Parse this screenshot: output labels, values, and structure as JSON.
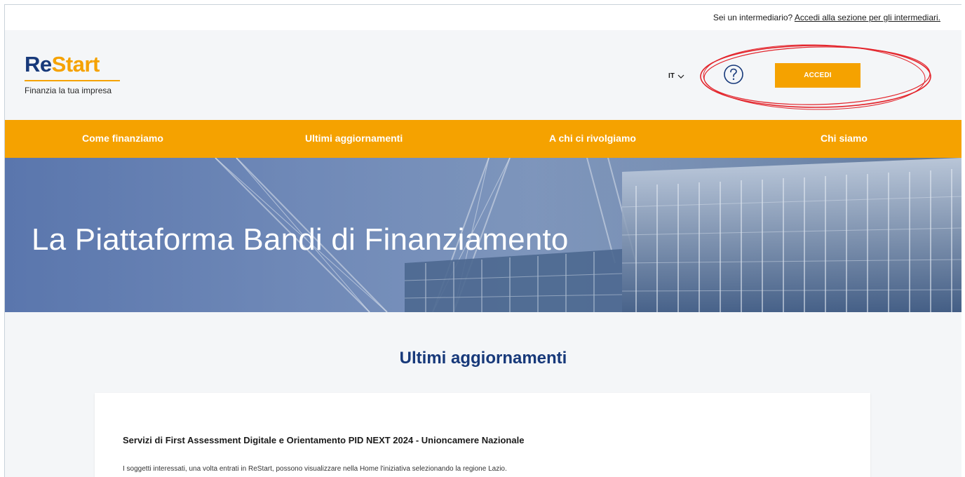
{
  "topbar": {
    "question": "Sei un intermediario?",
    "link": "Accedi alla sezione per gli intermediari."
  },
  "logo": {
    "part1": "Re",
    "part2": "Start",
    "tagline": "Finanzia la tua impresa"
  },
  "header": {
    "language": "IT",
    "help_icon": "question-circle-icon",
    "login_label": "ACCEDI"
  },
  "nav": {
    "items": [
      {
        "label": "Come finanziamo"
      },
      {
        "label": "Ultimi aggiornamenti"
      },
      {
        "label": "A chi ci rivolgiamo"
      },
      {
        "label": "Chi siamo"
      }
    ]
  },
  "hero": {
    "title": "La Piattaforma Bandi di Finanziamento"
  },
  "updates": {
    "title": "Ultimi aggiornamenti",
    "items": [
      {
        "title": "Servizi di First Assessment Digitale e Orientamento PID NEXT 2024 - Unioncamere Nazionale",
        "text": "I soggetti interessati, una volta entrati in ReStart, possono visualizzare nella Home l'iniziativa selezionando la regione Lazio."
      }
    ]
  },
  "colors": {
    "accent": "#f5a200",
    "brand_blue": "#17397a",
    "annotation": "#e3242b"
  }
}
